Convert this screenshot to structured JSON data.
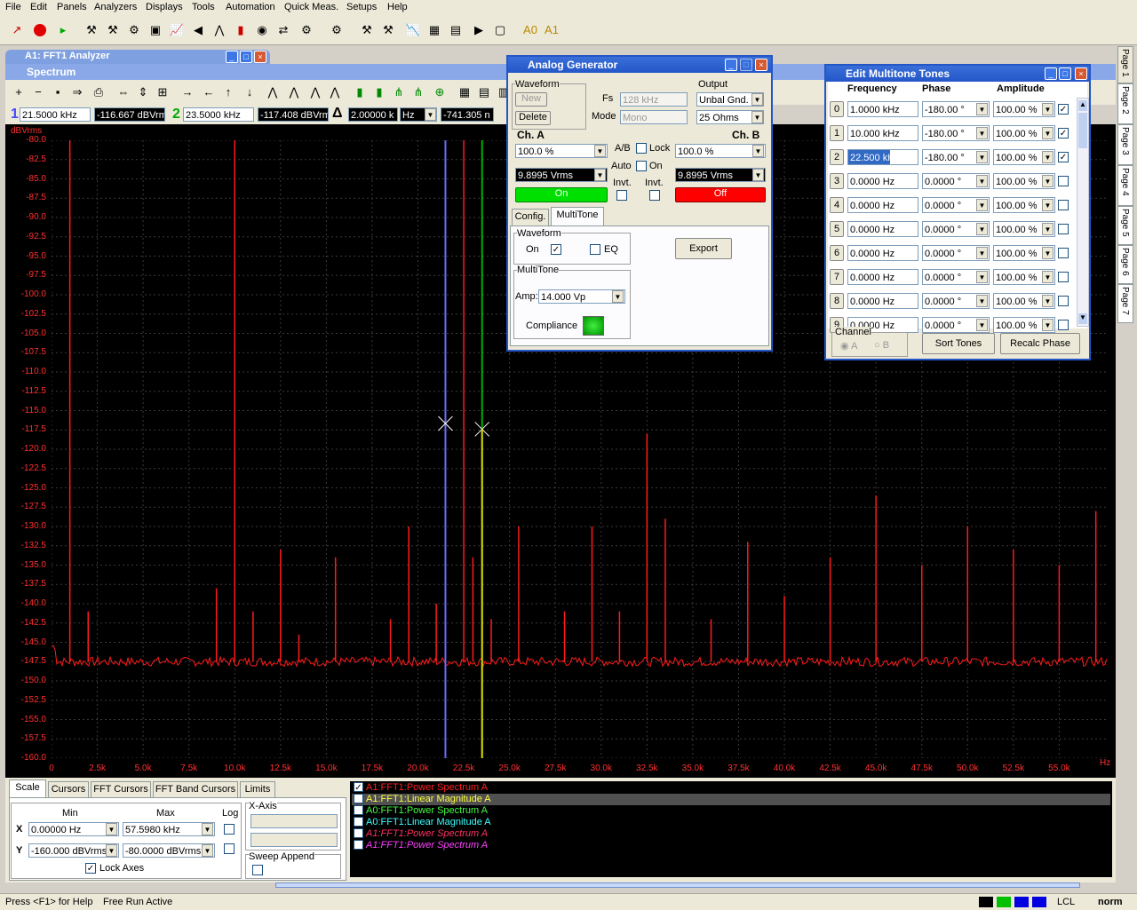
{
  "menu": [
    "File",
    "Edit",
    "Panels",
    "Analyzers",
    "Displays",
    "Tools",
    "Automation",
    "Quick Meas.",
    "Setups",
    "Help"
  ],
  "analyzer_title": "A1: FFT1 Analyzer",
  "spectrum_title": "Spectrum",
  "cursor_bar": {
    "c1_label": "1",
    "c1_freq": "21.5000 kHz",
    "c1_val": "-116.667 dBVrm",
    "c2_label": "2",
    "c2_freq": "23.5000 kHz",
    "c2_val": "-117.408 dBVrm",
    "delta_label": "Δ",
    "delta_freq": "2.00000 k",
    "delta_unit": "Hz",
    "delta_val": "-741.305 n"
  },
  "plot": {
    "y_unit": "dBVrms",
    "x_unit": "Hz",
    "y_ticks": [
      "-80.0",
      "-82.5",
      "-85.0",
      "-87.5",
      "-90.0",
      "-92.5",
      "-95.0",
      "-97.5",
      "-100.0",
      "-102.5",
      "-105.0",
      "-107.5",
      "-110.0",
      "-112.5",
      "-115.0",
      "-117.5",
      "-120.0",
      "-122.5",
      "-125.0",
      "-127.5",
      "-130.0",
      "-132.5",
      "-135.0",
      "-137.5",
      "-140.0",
      "-142.5",
      "-145.0",
      "-147.5",
      "-150.0",
      "-152.5",
      "-155.0",
      "-157.5",
      "-160.0"
    ],
    "x_ticks": [
      "0",
      "2.5k",
      "5.0k",
      "7.5k",
      "10.0k",
      "12.5k",
      "15.0k",
      "17.5k",
      "20.0k",
      "22.5k",
      "25.0k",
      "27.5k",
      "30.0k",
      "32.5k",
      "35.0k",
      "37.5k",
      "40.0k",
      "42.5k",
      "45.0k",
      "47.5k",
      "50.0k",
      "52.5k",
      "55.0k"
    ]
  },
  "chart_data": {
    "type": "line",
    "xlabel": "Hz",
    "ylabel": "dBVrms",
    "xlim": [
      0,
      57598
    ],
    "ylim": [
      -160,
      -80
    ],
    "grid": true,
    "noise_floor_dbvrms": -147.5,
    "peaks_hz": [
      1000,
      2000,
      9000,
      10000,
      11000,
      12500,
      13500,
      15500,
      18500,
      19500,
      21000,
      22500,
      23000,
      24000,
      25500,
      28000,
      29500,
      31000,
      32500,
      33500,
      36000,
      38000,
      40000,
      42500,
      45000,
      47500,
      50000,
      52500,
      55000,
      57000
    ],
    "peaks_dbvrms": [
      -80,
      -141,
      -138,
      -80,
      -141,
      -133,
      -144,
      -134,
      -142,
      -130,
      -140,
      -80,
      -134,
      -142,
      -130,
      -141,
      -130,
      -141,
      -118,
      -129,
      -142,
      -132,
      -139,
      -134,
      -126,
      -135,
      -130,
      -133,
      -135,
      -128
    ],
    "cursors": [
      {
        "label": "1",
        "x": 21500,
        "y": -116.667,
        "color": "#6a6aff"
      },
      {
        "label": "2",
        "x": 23500,
        "y": -117.408,
        "color": "#00b000"
      }
    ],
    "series_color": "#ff1a1a"
  },
  "bottom": {
    "tabs": [
      "Scale",
      "Cursors",
      "FFT Cursors",
      "FFT Band Cursors",
      "Limits"
    ],
    "min_label": "Min",
    "max_label": "Max",
    "log_label": "Log",
    "xaxis_label": "X-Axis",
    "x_label": "X",
    "y_label": "Y",
    "x_min": "0.00000 Hz",
    "x_max": "57.5980 kHz",
    "y_min": "-160.000 dBVrms",
    "y_max": "-80.0000 dBVrms",
    "lock_axes": "Lock Axes",
    "sweep_append": "Sweep Append"
  },
  "legend": [
    {
      "text": "A1:FFT1:Power Spectrum A",
      "color": "#ff2020",
      "checked": true,
      "italic": false
    },
    {
      "text": "A1:FFT1:Linear Magnitude A",
      "color": "#ffff40",
      "checked": false,
      "italic": false
    },
    {
      "text": "A0:FFT1:Power Spectrum A",
      "color": "#40ff40",
      "checked": false,
      "italic": false
    },
    {
      "text": "A0:FFT1:Linear Magnitude A",
      "color": "#40ffff",
      "checked": false,
      "italic": false
    },
    {
      "text": "A1:FFT1:Power Spectrum A",
      "color": "#ff3060",
      "checked": false,
      "italic": true
    },
    {
      "text": "A1:FFT1:Power Spectrum A",
      "color": "#ff40ff",
      "checked": false,
      "italic": true
    }
  ],
  "generator": {
    "title": "Analog Generator",
    "waveform_label": "Waveform",
    "new_btn": "New",
    "delete_btn": "Delete",
    "fs_label": "Fs",
    "fs_value": "128 kHz",
    "mode_label": "Mode",
    "mode_value": "Mono",
    "output_label": "Output",
    "output_value": "Unbal Gnd.",
    "impedance_value": "25 Ohms",
    "cha_label": "Ch. A",
    "chb_label": "Ch. B",
    "cha_pct": "100.0 %",
    "chb_pct": "100.0 %",
    "cha_vrms": "9.8995 Vrms",
    "chb_vrms": "9.8995 Vrms",
    "ab_label": "A/B",
    "lock_label": "Lock",
    "auto_label": "Auto",
    "on_label": "On",
    "cha_state": "On",
    "chb_state": "Off",
    "invt_label": "Invt.",
    "tab_config": "Config.",
    "tab_multitone": "MultiTone",
    "wf_group": "Waveform",
    "wf_on": "On",
    "wf_eq": "EQ",
    "export_btn": "Export",
    "multitone_group": "MultiTone",
    "amp_label": "Amp:",
    "amp_value": "14.000 Vp",
    "compliance_label": "Compliance"
  },
  "multitone": {
    "title": "Edit Multitone Tones",
    "headers": [
      "Frequency",
      "Phase",
      "Amplitude"
    ],
    "rows": [
      {
        "idx": "0",
        "freq": "1.0000 kHz",
        "phase": "-180.00 °",
        "amp": "100.00 %",
        "on": true
      },
      {
        "idx": "1",
        "freq": "10.000 kHz",
        "phase": "-180.00 °",
        "amp": "100.00 %",
        "on": true
      },
      {
        "idx": "2",
        "freq": "22.500 kHz",
        "phase": "-180.00 °",
        "amp": "100.00 %",
        "on": true
      },
      {
        "idx": "3",
        "freq": "0.0000 Hz",
        "phase": "0.0000 °",
        "amp": "100.00 %",
        "on": false
      },
      {
        "idx": "4",
        "freq": "0.0000 Hz",
        "phase": "0.0000 °",
        "amp": "100.00 %",
        "on": false
      },
      {
        "idx": "5",
        "freq": "0.0000 Hz",
        "phase": "0.0000 °",
        "amp": "100.00 %",
        "on": false
      },
      {
        "idx": "6",
        "freq": "0.0000 Hz",
        "phase": "0.0000 °",
        "amp": "100.00 %",
        "on": false
      },
      {
        "idx": "7",
        "freq": "0.0000 Hz",
        "phase": "0.0000 °",
        "amp": "100.00 %",
        "on": false
      },
      {
        "idx": "8",
        "freq": "0.0000 Hz",
        "phase": "0.0000 °",
        "amp": "100.00 %",
        "on": false
      },
      {
        "idx": "9",
        "freq": "0.0000 Hz",
        "phase": "0.0000 °",
        "amp": "100.00 %",
        "on": false
      }
    ],
    "channel_label": "Channel",
    "ch_a": "A",
    "ch_b": "B",
    "sort_btn": "Sort Tones",
    "recalc_btn": "Recalc Phase"
  },
  "pages": [
    "Page 1",
    "Page 2",
    "Page 3",
    "Page 4",
    "Page 5",
    "Page 6",
    "Page 7"
  ],
  "status": {
    "help": "Press <F1> for Help",
    "run": "Free Run Active",
    "lcl": "LCL",
    "norm": "norm"
  }
}
